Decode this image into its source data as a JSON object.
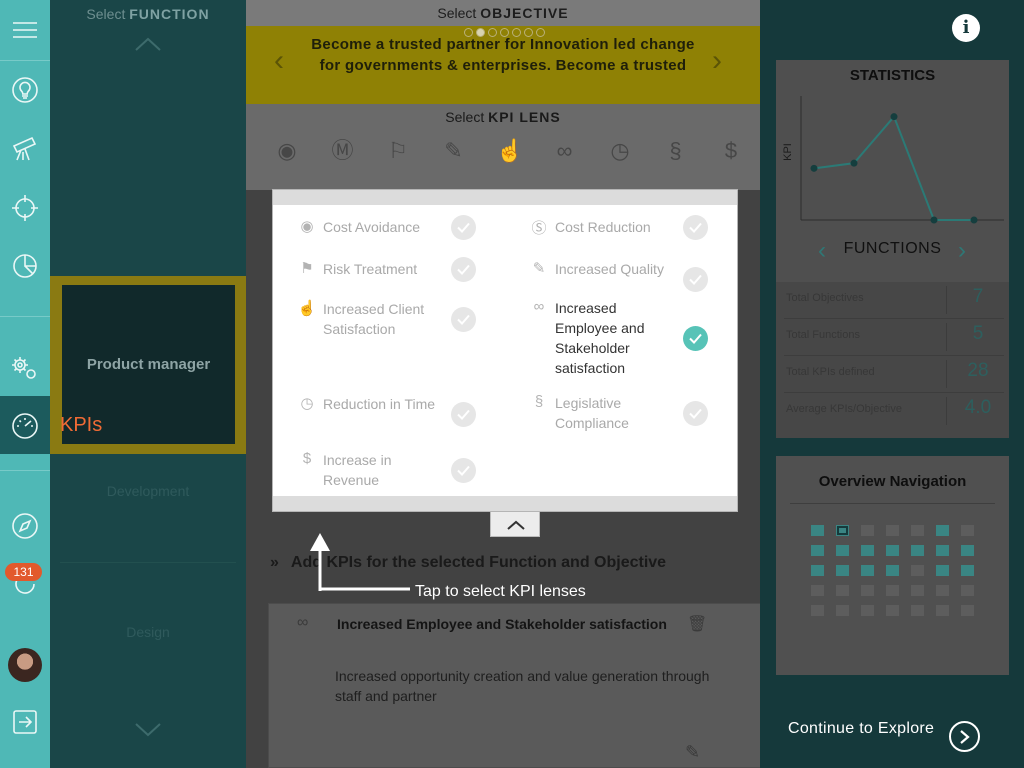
{
  "function_panel": {
    "select_prefix": "Select",
    "select_bold": "FUNCTION",
    "active_function": "Product manager",
    "active_tab_label": "KPIs",
    "items": [
      "Development",
      "Design"
    ]
  },
  "notification_count": "131",
  "objective": {
    "select_prefix": "Select",
    "select_bold": "OBJECTIVE",
    "text": "Become a trusted partner for Innovation led change for governments & enterprises. Become a trusted",
    "page_count": 7,
    "current_page": 2
  },
  "kpi_lens": {
    "select_prefix": "Select",
    "select_bold": "KPI LENS",
    "icons": [
      "piggy-bank-icon",
      "dollar-circle-icon",
      "flag-icon",
      "quality-icon",
      "thumbs-up-icon",
      "handshake-icon",
      "stopwatch-icon",
      "legal-icon",
      "dollar-icon"
    ],
    "options": [
      {
        "label": "Cost Avoidance",
        "selected": false,
        "icon": "piggy-bank-icon"
      },
      {
        "label": "Cost Reduction",
        "selected": false,
        "icon": "dollar-circle-icon"
      },
      {
        "label": "Risk Treatment",
        "selected": false,
        "icon": "flag-icon"
      },
      {
        "label": "Increased Quality",
        "selected": false,
        "icon": "quality-icon"
      },
      {
        "label": "Increased Client Satisfaction",
        "selected": false,
        "icon": "thumbs-up-icon"
      },
      {
        "label": "Increased Employee and Stakeholder satisfaction",
        "selected": true,
        "icon": "handshake-icon"
      },
      {
        "label": "Reduction in Time",
        "selected": false,
        "icon": "stopwatch-icon"
      },
      {
        "label": "Legislative Compliance",
        "selected": false,
        "icon": "legal-icon"
      },
      {
        "label": "Increase in Revenue",
        "selected": false,
        "icon": "dollar-icon"
      }
    ]
  },
  "hint": {
    "text": "Tap to select KPI lenses"
  },
  "add_kpis": {
    "title": "Add KPIs for the selected Function and Objective",
    "card_title": "Increased Employee and Stakeholder satisfaction",
    "card_description": "Increased opportunity creation and value generation through staff and partner"
  },
  "statistics": {
    "title": "STATISTICS",
    "y_label": "KPI",
    "nav_label": "FUNCTIONS",
    "rows": [
      {
        "label": "Total Objectives",
        "value": "7"
      },
      {
        "label": "Total Functions",
        "value": "5"
      },
      {
        "label": "Total KPIs defined",
        "value": "28"
      },
      {
        "label": "Average KPIs/Objective",
        "value": "4.0"
      }
    ]
  },
  "chart_data": {
    "type": "line",
    "ylabel": "KPI",
    "series": [
      {
        "values": [
          10,
          11,
          20,
          0,
          0
        ]
      }
    ],
    "ylim": [
      0,
      24
    ],
    "grid": false
  },
  "overview_navigation": {
    "title": "Overview Navigation",
    "rows": [
      [
        "teal",
        "current",
        "off",
        "off",
        "off",
        "teal",
        "off"
      ],
      [
        "teal",
        "teal",
        "teal",
        "teal",
        "teal",
        "teal",
        "teal"
      ],
      [
        "teal",
        "teal",
        "teal",
        "teal",
        "off",
        "teal",
        "teal"
      ],
      [
        "off",
        "off",
        "off",
        "off",
        "off",
        "off",
        "off"
      ],
      [
        "off",
        "off",
        "off",
        "off",
        "off",
        "off",
        "off"
      ]
    ]
  },
  "footer": {
    "continue_label": "Continue to Explore"
  },
  "colors": {
    "accent_teal": "#57c3b7",
    "kpi_orange": "#f06b35",
    "banner_yellow": "#8f8105"
  }
}
